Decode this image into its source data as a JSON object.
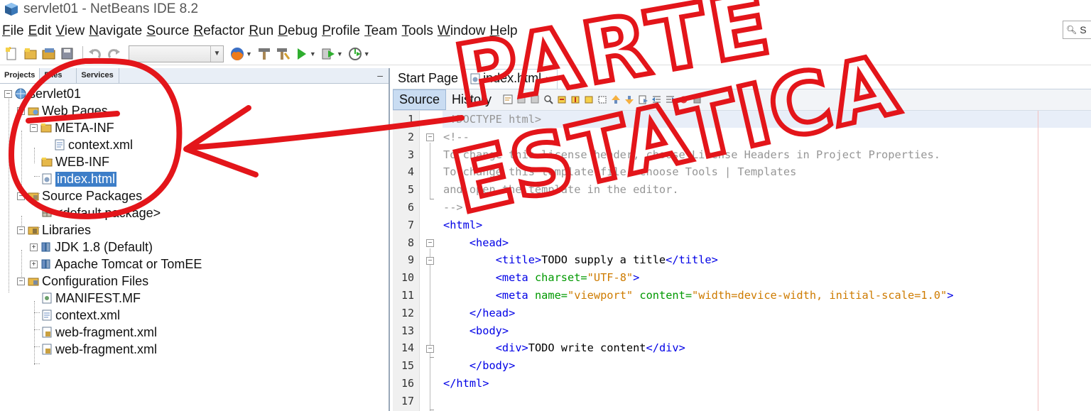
{
  "window": {
    "title": "servlet01 - NetBeans IDE 8.2"
  },
  "menu": [
    "File",
    "Edit",
    "View",
    "Navigate",
    "Source",
    "Refactor",
    "Run",
    "Debug",
    "Profile",
    "Team",
    "Tools",
    "Window",
    "Help"
  ],
  "search": {
    "value": "S"
  },
  "panel": {
    "tabs": [
      "Projects",
      "Files",
      "Services"
    ],
    "minimize": "–"
  },
  "tree": {
    "project": "servlet01",
    "web_pages": "Web Pages",
    "meta_inf": "META-INF",
    "context_xml": "context.xml",
    "web_inf": "WEB-INF",
    "index_html": "index.html",
    "source_packages": "Source Packages",
    "default_package": "<default package>",
    "libraries": "Libraries",
    "jdk": "JDK 1.8 (Default)",
    "tomcat": "Apache Tomcat or TomEE",
    "config_files": "Configuration Files",
    "manifest": "MANIFEST.MF",
    "config_context": "context.xml",
    "web_fragment_1": "web-fragment.xml",
    "web_fragment_2": "web-fragment.xml"
  },
  "editor": {
    "tabs": [
      "Start Page",
      "index.html"
    ],
    "close": "×",
    "view_tabs": [
      "Source",
      "History"
    ]
  },
  "code": {
    "line_numbers": [
      "1",
      "2",
      "3",
      "4",
      "5",
      "6",
      "7",
      "8",
      "9",
      "10",
      "11",
      "12",
      "13",
      "14",
      "15",
      "16",
      "17"
    ],
    "l1": "<!DOCTYPE html>",
    "l2": "<!--",
    "l3": "To change this license header, choose License Headers in Project Properties.",
    "l4": "To change this template file, choose Tools | Templates",
    "l5": "and open the template in the editor.",
    "l6": "-->",
    "l7": "<html>",
    "l8": "<head>",
    "l9_open": "<title>",
    "l9_text": "TODO supply a title",
    "l9_close": "</title>",
    "l10_tag": "<meta",
    "l10_attr": "charset=",
    "l10_val": "\"UTF-8\"",
    "l10_end": ">",
    "l11_tag": "<meta",
    "l11_attr1": "name=",
    "l11_val1": "\"viewport\"",
    "l11_attr2": "content=",
    "l11_val2": "\"width=device-width, initial-scale=1.0\"",
    "l11_end": ">",
    "l12": "</head>",
    "l13": "<body>",
    "l14_open": "<div>",
    "l14_text": "TODO write content",
    "l14_close": "</div>",
    "l15": "</body>",
    "l16": "</html>"
  },
  "annotation": {
    "text_line1": "PARTE",
    "text_line2": "ESTATICA",
    "color": "#e3151a"
  },
  "colors": {
    "selection": "#3d7ec8",
    "comment": "#969696",
    "tag": "#0000e6",
    "attribute": "#009900",
    "value": "#ce7b00"
  }
}
